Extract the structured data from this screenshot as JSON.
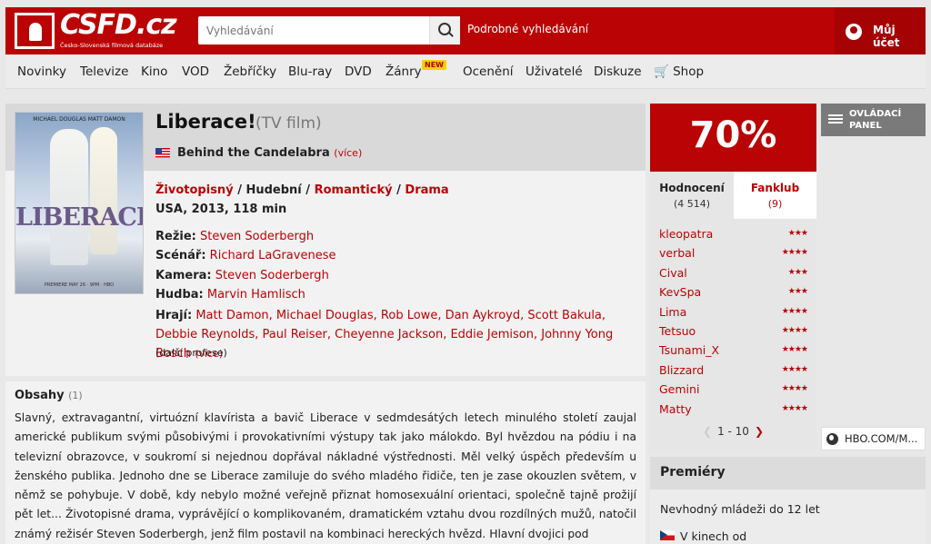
{
  "header": {
    "logo_text": "CSFD.cz",
    "logo_sub": "Česko-Slovenská filmová databáze",
    "search_placeholder": "Vyhledávání",
    "advanced_search": "Podrobné vyhledávání",
    "account": "Můj účet"
  },
  "nav": {
    "items": [
      "Novinky",
      "Televize",
      "Kino",
      "VOD",
      "Žebříčky",
      "Blu-ray",
      "DVD",
      "Žánry",
      "Ocenění",
      "Uživatelé",
      "Diskuze",
      "🛒 Shop"
    ],
    "new_badge": "NEW"
  },
  "film": {
    "poster_names": "MICHAEL DOUGLAS        MATT DAMON",
    "poster_title": "LIBERACE!",
    "poster_foot": "PREMIERE MAY 26 · 9PM · HBO",
    "title": "Liberace!",
    "type": "(TV film)",
    "alt_title": "Behind the Candelabra",
    "alt_more": "(více)",
    "genres": [
      "Životopisný",
      "Hudební",
      "Romantický",
      "Drama"
    ],
    "genre_sep": " / ",
    "origin": "USA, 2013, 118 min",
    "directing_label": "Režie:",
    "directing": "Steven Soderbergh",
    "writing_label": "Scénář:",
    "writing": "Richard LaGravenese",
    "camera_label": "Kamera:",
    "camera": "Steven Soderbergh",
    "music_label": "Hudba:",
    "music": "Marvin Hamlisch",
    "cast_label": "Hrají:",
    "cast": "Matt Damon, Michael Douglas, Rob Lowe, Dan Aykroyd, Scott Bakula, Debbie Reynolds, Paul Reiser, Cheyenne Jackson, Eddie Jemison, Johnny Yong Bosch",
    "cast_more": "(více)",
    "more_professions": "(další profese)"
  },
  "plot": {
    "heading": "Obsahy",
    "count": "(1)",
    "text": "Slavný, extravagantní, virtuózní klavírista a bavič Liberace v sedmdesátých letech minulého století zaujal americké publikum svými působivými i provokativními výstupy tak jako málokdo. Byl hvězdou na pódiu i na televizní obrazovce, v soukromí si nejednou dopřával nákladné výstřednosti. Měl velký úspěch především u ženského publika. Jednoho dne se Liberace zamiluje do svého mladého řidiče, ten je zase okouzlen světem, v němž se pohybuje. V době, kdy nebylo možné veřejně přiznat homosexuální orientaci, společně tajně prožijí pět let... Životopisné drama, vyprávějící o komplikovaném, dramatickém vztahu dvou rozdílných mužů, natočil známý režisér Steven Soderbergh, jenž film postavil na kombinaci hereckých hvězd. Hlavní dvojici pod"
  },
  "rating": {
    "percent": "70%",
    "tab_ratings": "Hodnocení",
    "tab_ratings_count": "(4 514)",
    "tab_fanclub": "Fanklub",
    "tab_fanclub_count": "(9)",
    "raters": [
      {
        "name": "kleopatra",
        "stars": 3
      },
      {
        "name": "verbal",
        "stars": 4
      },
      {
        "name": "Cival",
        "stars": 3
      },
      {
        "name": "KevSpa",
        "stars": 3
      },
      {
        "name": "Lima",
        "stars": 4
      },
      {
        "name": "Tetsuo",
        "stars": 4
      },
      {
        "name": "Tsunami_X",
        "stars": 4
      },
      {
        "name": "Blizzard",
        "stars": 4
      },
      {
        "name": "Gemini",
        "stars": 4
      },
      {
        "name": "Matty",
        "stars": 4
      }
    ],
    "pager": "1 - 10"
  },
  "sidebar": {
    "control_panel": "OVLÁDACÍ PANEL",
    "hbo_link": "HBO.COM/M..."
  },
  "premieres": {
    "heading": "Premiéry",
    "age": "Nevhodný mládeži do 12 let",
    "cinema": "V kinech od"
  },
  "colors": {
    "brand_red": "#ba0305",
    "badge_yellow": "#f4d000"
  }
}
